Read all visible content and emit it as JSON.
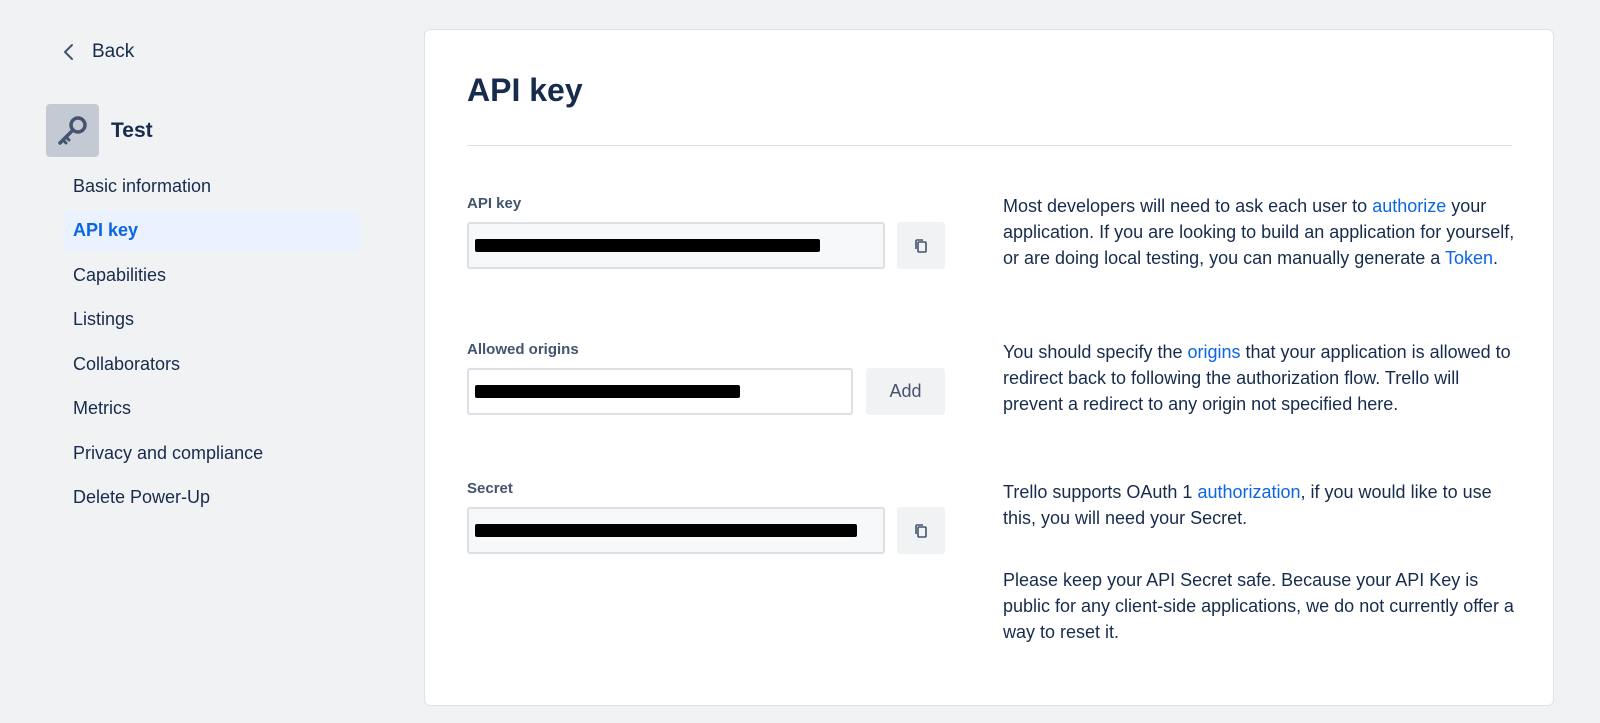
{
  "sidebar": {
    "back_label": "Back",
    "app_name": "Test",
    "app_icon": "key-icon",
    "items": [
      {
        "label": "Basic information",
        "active": false
      },
      {
        "label": "API key",
        "active": true
      },
      {
        "label": "Capabilities",
        "active": false
      },
      {
        "label": "Listings",
        "active": false
      },
      {
        "label": "Collaborators",
        "active": false
      },
      {
        "label": "Metrics",
        "active": false
      },
      {
        "label": "Privacy and compliance",
        "active": false
      },
      {
        "label": "Delete Power-Up",
        "active": false
      }
    ]
  },
  "main": {
    "title": "API key",
    "api_key": {
      "label": "API key",
      "value": "[redacted]",
      "copy_icon": "copy-icon",
      "description": {
        "before": "Most developers will need to ask each user to ",
        "link1": "authorize",
        "middle": " your application. If you are looking to build an application for yourself, or are doing local testing, you can manually generate a ",
        "link2": "Token",
        "after": "."
      }
    },
    "allowed_origins": {
      "label": "Allowed origins",
      "value": "[redacted]",
      "add_label": "Add",
      "description": {
        "before": "You should specify the ",
        "link": "origins",
        "after": " that your application is allowed to redirect back to following the authorization flow. Trello will prevent a redirect to any origin not specified here."
      }
    },
    "secret": {
      "label": "Secret",
      "value": "[redacted]",
      "copy_icon": "copy-icon",
      "description": {
        "before": "Trello supports OAuth 1 ",
        "link": "authorization",
        "after": ", if you would like to use this, you will need your Secret."
      },
      "note": "Please keep your API Secret safe. Because your API Key is public for any client-side applications, we do not currently offer a way to reset it."
    }
  },
  "colors": {
    "link": "#0c66e4",
    "active_bg": "#e9f2fe",
    "text": "#172b4d"
  }
}
